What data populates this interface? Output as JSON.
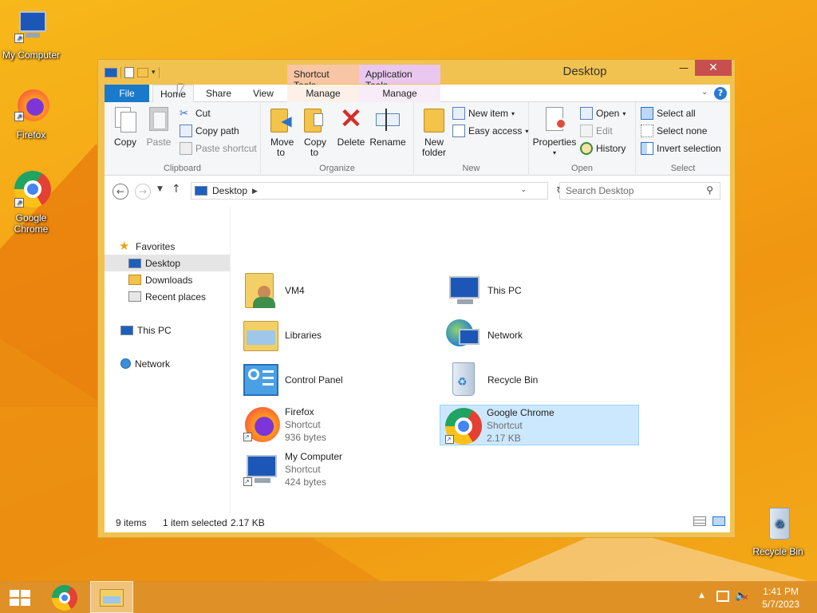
{
  "desktop": {
    "icons": [
      {
        "label": "My Computer",
        "icon": "computer-icon"
      },
      {
        "label": "Firefox",
        "icon": "firefox-icon"
      },
      {
        "label": "Google Chrome",
        "icon": "chrome-icon"
      },
      {
        "label": "Recycle Bin",
        "icon": "recycle-bin-icon"
      }
    ]
  },
  "window": {
    "title": "Desktop",
    "context_tabs": {
      "shortcut": "Shortcut Tools",
      "application": "Application Tools"
    },
    "tabs": [
      "File",
      "Home",
      "Share",
      "View",
      "Manage",
      "Manage"
    ],
    "controls": {
      "minimize": "—",
      "maximize": "□",
      "close": "✕"
    }
  },
  "ribbon": {
    "clipboard": {
      "label": "Clipboard",
      "copy": "Copy",
      "paste": "Paste",
      "cut": "Cut",
      "copy_path": "Copy path",
      "paste_shortcut": "Paste shortcut"
    },
    "organize": {
      "label": "Organize",
      "move_to": "Move to",
      "copy_to": "Copy to",
      "delete": "Delete",
      "rename": "Rename"
    },
    "new": {
      "label": "New",
      "new_folder": "New folder",
      "new_item": "New item",
      "easy_access": "Easy access"
    },
    "open": {
      "label": "Open",
      "properties": "Properties",
      "open": "Open",
      "edit": "Edit",
      "history": "History"
    },
    "select": {
      "label": "Select",
      "select_all": "Select all",
      "select_none": "Select none",
      "invert": "Invert selection"
    }
  },
  "address": {
    "path": "Desktop",
    "search_placeholder": "Search Desktop"
  },
  "nav_pane": {
    "favorites": "Favorites",
    "desktop": "Desktop",
    "downloads": "Downloads",
    "recent": "Recent places",
    "this_pc": "This PC",
    "network": "Network"
  },
  "items": [
    {
      "name": "VM4",
      "type": "",
      "size": ""
    },
    {
      "name": "This PC",
      "type": "",
      "size": ""
    },
    {
      "name": "Libraries",
      "type": "",
      "size": ""
    },
    {
      "name": "Network",
      "type": "",
      "size": ""
    },
    {
      "name": "Control Panel",
      "type": "",
      "size": ""
    },
    {
      "name": "Recycle Bin",
      "type": "",
      "size": ""
    },
    {
      "name": "Firefox",
      "type": "Shortcut",
      "size": "936 bytes"
    },
    {
      "name": "Google Chrome",
      "type": "Shortcut",
      "size": "2.17 KB"
    },
    {
      "name": "My Computer",
      "type": "Shortcut",
      "size": "424 bytes"
    }
  ],
  "status": {
    "count": "9 items",
    "selection": "1 item selected",
    "size": "2.17 KB"
  },
  "taskbar": {
    "time": "1:41 PM",
    "date": "5/7/2023"
  },
  "colors": {
    "file_tab": "#1979ca",
    "shortcut_tools": "#f8c6a4",
    "application_tools": "#e9c7ee",
    "selection": "#cce8ff"
  }
}
